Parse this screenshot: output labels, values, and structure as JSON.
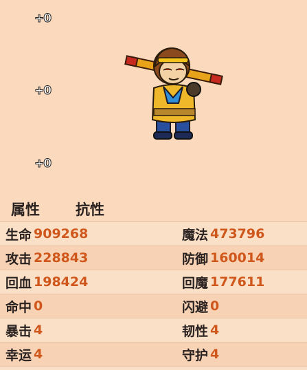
{
  "equipment_slots": [
    {
      "bonus": "+0"
    },
    {
      "bonus": "+0"
    },
    {
      "bonus": "+0"
    }
  ],
  "tabs": {
    "attributes": "属性",
    "resistance": "抗性"
  },
  "stats": [
    {
      "left_label": "生命",
      "left_value": "909268",
      "right_label": "魔法",
      "right_value": "473796"
    },
    {
      "left_label": "攻击",
      "left_value": "228843",
      "right_label": "防御",
      "right_value": "160014"
    },
    {
      "left_label": "回血",
      "left_value": "198424",
      "right_label": "回魔",
      "right_value": "177611"
    },
    {
      "left_label": "命中",
      "left_value": "0",
      "right_label": "闪避",
      "right_value": "0"
    },
    {
      "left_label": "暴击",
      "left_value": "4",
      "right_label": "韧性",
      "right_value": "4"
    },
    {
      "left_label": "幸运",
      "left_value": "4",
      "right_label": "守护",
      "right_value": "4"
    }
  ],
  "colors": {
    "background": "#fad9bc",
    "value": "#d0571b",
    "label": "#2a2220"
  }
}
